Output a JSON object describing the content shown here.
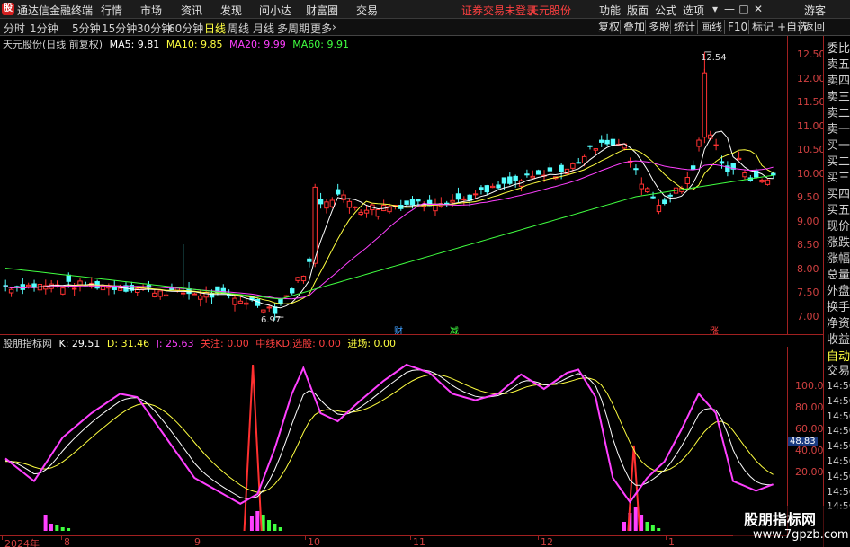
{
  "app": {
    "title": "通达信金融终端",
    "logo": "股"
  },
  "menu": [
    "行情",
    "市场",
    "资讯",
    "发现",
    "问小达",
    "财富圈",
    "交易"
  ],
  "warning": "证券交易未登录",
  "stock_name": "天元股份",
  "right_menu": [
    "功能",
    "版面",
    "公式",
    "选项"
  ],
  "guest": "游客",
  "window_buttons": [
    "▾",
    "—",
    "□",
    "✕"
  ],
  "periods": [
    "分时",
    "1分钟",
    "5分钟",
    "15分钟",
    "30分钟",
    "60分钟",
    "日线",
    "周线",
    "月线",
    "多周期",
    "更多"
  ],
  "active_period": "日线",
  "tools": [
    "复权",
    "叠加",
    "多股",
    "统计",
    "画线",
    "F10",
    "标记",
    "+自选",
    "返回"
  ],
  "main_legend": {
    "title": "天元股份(日线 前复权)",
    "ma5": "MA5: 9.81",
    "ma10": "MA10: 9.85",
    "ma20": "MA20: 9.99",
    "ma60": "MA60: 9.91"
  },
  "kdj_legend": {
    "name": "股朋指标网",
    "k": "K: 29.51",
    "d": "D: 31.46",
    "j": "J: 25.63",
    "gz": "关注: 0.00",
    "zx": "中线KDJ选股: 0.00",
    "jc": "进场: 0.00"
  },
  "price_axis": [
    "12.50",
    "12.00",
    "11.50",
    "11.00",
    "10.50",
    "10.00",
    "9.50",
    "9.00",
    "8.50",
    "8.00",
    "7.50",
    "7.00"
  ],
  "kdj_axis": [
    "100.00",
    "80.00",
    "60.00",
    "40.00",
    "20.00"
  ],
  "kdj_badge": "48.83",
  "annotations": {
    "high": "12.54",
    "low": "6.97",
    "m1": "财",
    "m2": "减",
    "m3": "涨"
  },
  "time_axis": [
    "2024年",
    "8",
    "9",
    "10",
    "11",
    "12",
    "1"
  ],
  "side_panel": {
    "items": [
      "委比",
      "卖五",
      "卖四",
      "卖三",
      "卖二",
      "卖一",
      "买一",
      "买二",
      "买三",
      "买四",
      "买五",
      "现价",
      "涨跌",
      "涨幅",
      "总量",
      "外盘",
      "换手",
      "净资",
      "收益"
    ],
    "auto": "自动",
    "trade": "交易",
    "times": [
      "14:56",
      "14:56",
      "14:56",
      "14:56",
      "14:56",
      "14:56",
      "14:56",
      "14:56",
      "14:56"
    ]
  },
  "watermark": {
    "line1": "股朋指标网",
    "line2": "www.7gpzb.com"
  },
  "colors": {
    "up": "#ff3232",
    "down": "#54ffff",
    "ma5": "#ffffff",
    "ma10": "#ffff40",
    "ma20": "#ff40ff",
    "ma60": "#40ff40",
    "k": "#ffffff",
    "d": "#ffff40",
    "j": "#ff40ff",
    "axis": "#a02020"
  }
}
